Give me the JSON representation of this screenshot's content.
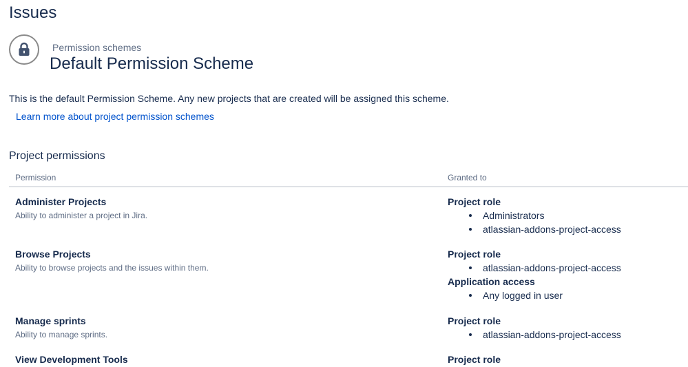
{
  "page": {
    "title": "Issues"
  },
  "scheme": {
    "breadcrumb": "Permission schemes",
    "title": "Default Permission Scheme",
    "description": "This is the default Permission Scheme. Any new projects that are created will be assigned this scheme.",
    "learn_more_link": "Learn more about project permission schemes"
  },
  "permissions_section": {
    "title": "Project permissions",
    "columns": {
      "permission": "Permission",
      "granted_to": "Granted to"
    },
    "rows": [
      {
        "name": "Administer Projects",
        "description": "Ability to administer a project in Jira.",
        "grants": [
          {
            "type": "Project role",
            "items": [
              "Administrators",
              "atlassian-addons-project-access"
            ]
          }
        ]
      },
      {
        "name": "Browse Projects",
        "description": "Ability to browse projects and the issues within them.",
        "grants": [
          {
            "type": "Project role",
            "items": [
              "atlassian-addons-project-access"
            ]
          },
          {
            "type": "Application access",
            "items": [
              "Any logged in user"
            ]
          }
        ]
      },
      {
        "name": "Manage sprints",
        "description": "Ability to manage sprints.",
        "grants": [
          {
            "type": "Project role",
            "items": [
              "atlassian-addons-project-access"
            ]
          }
        ]
      },
      {
        "name": "View Development Tools",
        "description": "",
        "grants": [
          {
            "type": "Project role",
            "items": []
          }
        ]
      }
    ]
  },
  "colors": {
    "link": "#0052cc",
    "text": "#172b4d",
    "muted": "#5e6c84",
    "border": "#dfe1e6"
  },
  "icons": {
    "scheme_icon": "lock-icon"
  }
}
